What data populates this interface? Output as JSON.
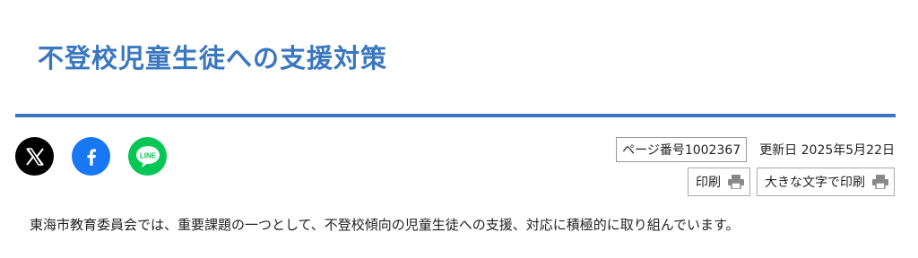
{
  "page": {
    "title": "不登校児童生徒への支援対策"
  },
  "share": {
    "icons": [
      "x-icon",
      "facebook-icon",
      "line-icon"
    ],
    "line_label": "LINE"
  },
  "meta": {
    "page_number": "ページ番号1002367",
    "updated": "更新日 2025年5月22日"
  },
  "print": {
    "print_label": "印刷",
    "large_print_label": "大きな文字で印刷",
    "icon": "printer-icon"
  },
  "content": {
    "intro": "東海市教育委員会では、重要課題の一つとして、不登校傾向の児童生徒への支援、対応に積極的に取り組んでいます。"
  },
  "colors": {
    "accent": "#3a77c0",
    "x": "#000000",
    "facebook": "#1877f2",
    "line": "#06c755"
  }
}
